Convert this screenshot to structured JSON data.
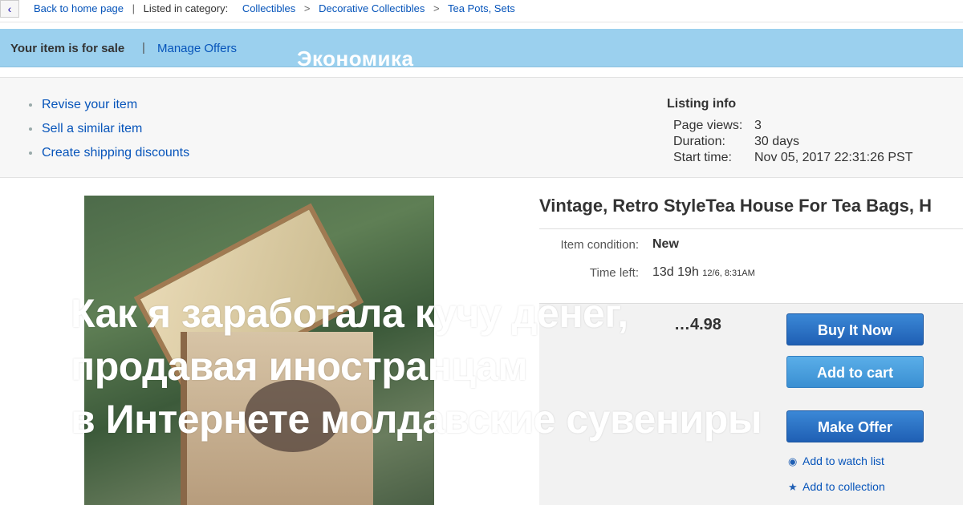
{
  "breadcrumb": {
    "back_label": "Back to home page",
    "listed_label": "Listed in category:",
    "items": [
      "Collectibles",
      "Decorative Collectibles",
      "Tea Pots, Sets"
    ]
  },
  "sale_bar": {
    "status": "Your item is for sale",
    "separator": "|",
    "manage_link": "Manage Offers"
  },
  "category_tag": "Экономика",
  "seller_actions": [
    "Revise your item",
    "Sell a similar item",
    "Create shipping discounts"
  ],
  "listing_info": {
    "title": "Listing info",
    "rows": [
      {
        "label": "Page views:",
        "value": "3"
      },
      {
        "label": "Duration:",
        "value": "30 days"
      },
      {
        "label": "Start time:",
        "value": "Nov 05, 2017 22:31:26 PST"
      }
    ]
  },
  "item": {
    "title": "Vintage, Retro StyleTea House For Tea Bags, H",
    "condition_label": "Item condition:",
    "condition_value": "New",
    "time_left_label": "Time left:",
    "time_left_value": "13d 19h",
    "time_left_date": "12/6, 8:31AM",
    "price": "…4.98"
  },
  "buttons": {
    "buy_now": "Buy It Now",
    "add_to_cart": "Add to cart",
    "make_offer": "Make Offer"
  },
  "links": {
    "watch_list": "Add to watch list",
    "collection": "Add to collection"
  },
  "headline": {
    "line1": "Как я заработала кучу денег,",
    "line2": "продавая иностранцам",
    "line3": "в Интернете молдавские сувениры"
  },
  "icons": {
    "back": "chevron-left-icon",
    "watch": "eye-icon",
    "collection": "star-icon"
  },
  "colors": {
    "sale_bar": "#9bd0ee",
    "link": "#0654ba",
    "button_blue": "#1f5fb4",
    "button_light": "#3a8fd2"
  }
}
